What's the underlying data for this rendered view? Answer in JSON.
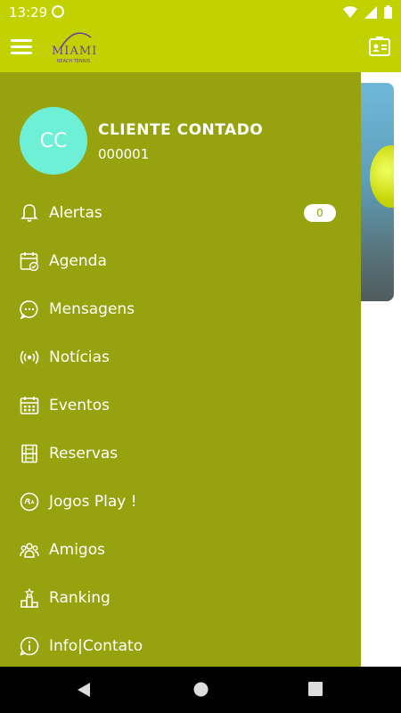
{
  "status_bar": {
    "time": "13:29"
  },
  "app_bar": {
    "logo_text": "MIAMI",
    "logo_subtext": "BEACH TENNIS"
  },
  "drawer": {
    "avatar_initials": "CC",
    "user_name": "CLIENTE CONTADO",
    "user_code": "000001",
    "menu": [
      {
        "label": "Alertas",
        "icon": "bell-icon",
        "badge": "0"
      },
      {
        "label": "Agenda",
        "icon": "calendar-check-icon"
      },
      {
        "label": "Mensagens",
        "icon": "chat-bubble-icon"
      },
      {
        "label": "Notícias",
        "icon": "broadcast-icon"
      },
      {
        "label": "Eventos",
        "icon": "calendar-grid-icon"
      },
      {
        "label": "Reservas",
        "icon": "court-icon"
      },
      {
        "label": "Jogos Play !",
        "icon": "play-badge-icon"
      },
      {
        "label": "Amigos",
        "icon": "friends-icon"
      },
      {
        "label": "Ranking",
        "icon": "podium-icon"
      },
      {
        "label": "Info|Contato",
        "icon": "info-icon"
      }
    ]
  },
  "colors": {
    "app_bar": "#c2d100",
    "drawer": "#96a20e",
    "avatar": "#6ef0d6"
  }
}
